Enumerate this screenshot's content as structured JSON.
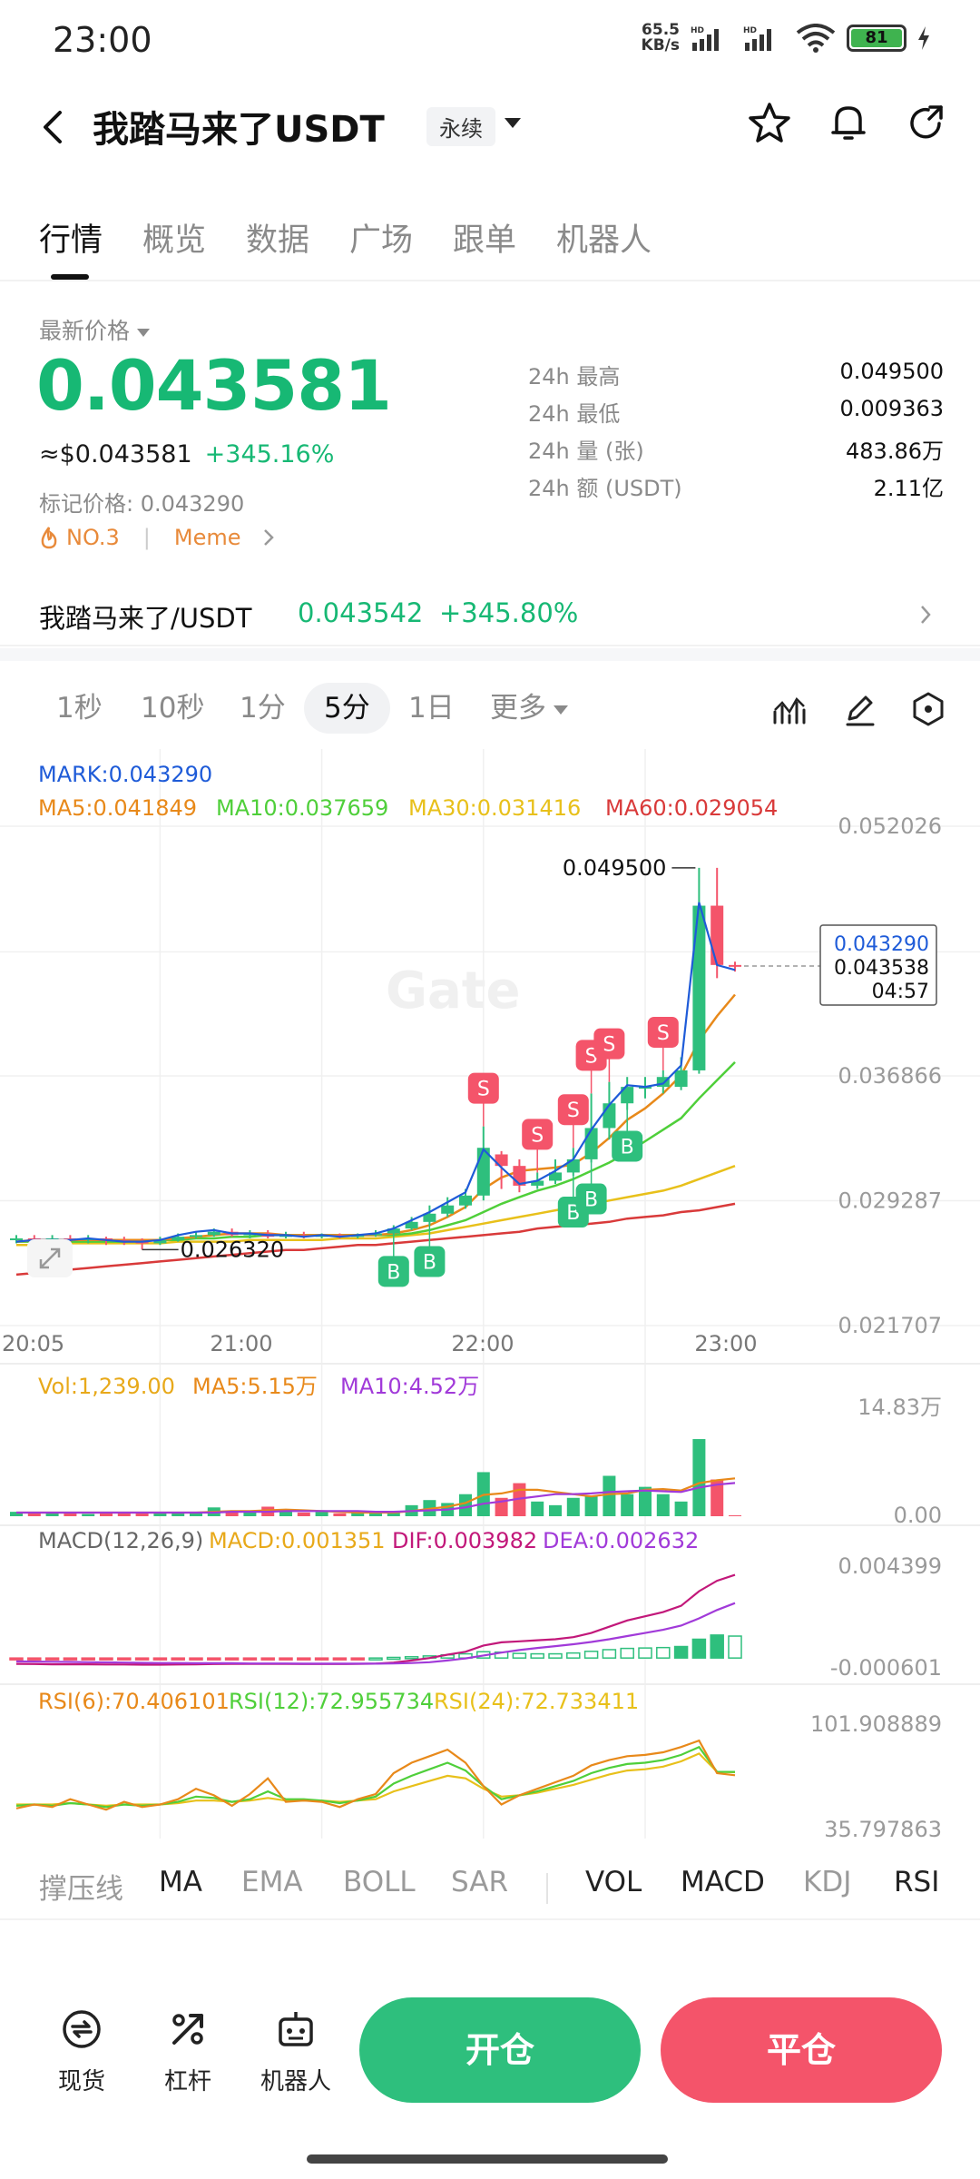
{
  "status_bar": {
    "time": "23:00",
    "net_speed_value": "65.5",
    "net_speed_unit": "KB/s",
    "battery": "81"
  },
  "header": {
    "title": "我踏马来了USDT",
    "contract_type": "永续"
  },
  "tabs": [
    "行情",
    "概览",
    "数据",
    "广场",
    "跟单",
    "机器人"
  ],
  "price": {
    "latest_label": "最新价格",
    "latest": "0.043581",
    "usd": "≈$0.043581",
    "change": "+345.16%",
    "mark_label": "标记价格: 0.043290",
    "rank_tag": "NO.3",
    "category_tag": "Meme"
  },
  "stats": [
    {
      "label": "24h  最高",
      "value": "0.049500"
    },
    {
      "label": "24h  最低",
      "value": "0.009363"
    },
    {
      "label": "24h  量 (张)",
      "value": "483.86万"
    },
    {
      "label": "24h  额 (USDT)",
      "value": "2.11亿"
    }
  ],
  "spot": {
    "name": "我踏马来了/USDT",
    "price": "0.043542",
    "change": "+345.80%"
  },
  "intervals": [
    "1秒",
    "10秒",
    "1分",
    "5分",
    "1日",
    "更多"
  ],
  "intervals_active": "5分",
  "chart": {
    "mark_legend": "MARK:0.043290",
    "ma_legend": [
      {
        "text": "MA5:0.041849",
        "color": "#e8891a"
      },
      {
        "text": "MA10:0.037659",
        "color": "#4fcf3a"
      },
      {
        "text": "MA30:0.031416",
        "color": "#e8c01a"
      },
      {
        "text": "MA60:0.029054",
        "color": "#d93a3a"
      }
    ],
    "watermark": "Gate",
    "high_label": "0.049500",
    "low_label": "0.026320",
    "price_box": {
      "mark": "0.043290",
      "last": "0.043538",
      "countdown": "04:57"
    },
    "vol_legend": [
      {
        "text": "Vol:1,239.00",
        "color": "#e8a91a"
      },
      {
        "text": "MA5:5.15万",
        "color": "#e8891a"
      },
      {
        "text": "MA10:4.52万",
        "color": "#a13ad9"
      }
    ],
    "vol_axis": {
      "top": "14.83万",
      "bottom": "0.00"
    },
    "macd_legend": [
      {
        "text": "MACD(12,26,9)",
        "color": "#666666"
      },
      {
        "text": "MACD:0.001351",
        "color": "#e8a91a"
      },
      {
        "text": "DIF:0.003982",
        "color": "#c2187a"
      },
      {
        "text": "DEA:0.002632",
        "color": "#a13ad9"
      }
    ],
    "macd_axis": {
      "top": "0.004399",
      "bottom": "-0.000601"
    },
    "rsi_legend": [
      {
        "text": "RSI(6):70.406101",
        "color": "#e8891a"
      },
      {
        "text": "RSI(12):72.955734",
        "color": "#4fcf3a"
      },
      {
        "text": "RSI(24):72.733411",
        "color": "#e8c01a"
      }
    ],
    "rsi_axis": {
      "top": "101.908889",
      "bottom": "35.797863"
    }
  },
  "chart_data": {
    "type": "candlestick",
    "x_ticks": [
      "20:05",
      "21:00",
      "22:00",
      "23:00"
    ],
    "y_ticks": [
      "0.052026",
      "0.036866",
      "0.029287",
      "0.021707"
    ],
    "ylim": [
      0.021707,
      0.052026
    ],
    "candles": [
      {
        "o": 0.0269,
        "c": 0.027,
        "h": 0.0272,
        "l": 0.0267
      },
      {
        "o": 0.027,
        "c": 0.0269,
        "h": 0.0272,
        "l": 0.0267
      },
      {
        "o": 0.0269,
        "c": 0.027,
        "h": 0.0272,
        "l": 0.0267
      },
      {
        "o": 0.027,
        "c": 0.0269,
        "h": 0.0272,
        "l": 0.0267
      },
      {
        "o": 0.0269,
        "c": 0.027,
        "h": 0.0272,
        "l": 0.0267
      },
      {
        "o": 0.027,
        "c": 0.0269,
        "h": 0.0271,
        "l": 0.0266
      },
      {
        "o": 0.0269,
        "c": 0.0268,
        "h": 0.0271,
        "l": 0.0266
      },
      {
        "o": 0.0268,
        "c": 0.0267,
        "h": 0.027,
        "l": 0.02632
      },
      {
        "o": 0.0267,
        "c": 0.0269,
        "h": 0.0271,
        "l": 0.0266
      },
      {
        "o": 0.0269,
        "c": 0.0271,
        "h": 0.0273,
        "l": 0.0268
      },
      {
        "o": 0.0271,
        "c": 0.0272,
        "h": 0.0274,
        "l": 0.027
      },
      {
        "o": 0.0272,
        "c": 0.0274,
        "h": 0.0276,
        "l": 0.0271
      },
      {
        "o": 0.0274,
        "c": 0.0272,
        "h": 0.0276,
        "l": 0.0271
      },
      {
        "o": 0.0272,
        "c": 0.0273,
        "h": 0.0275,
        "l": 0.027
      },
      {
        "o": 0.0273,
        "c": 0.0271,
        "h": 0.0275,
        "l": 0.027
      },
      {
        "o": 0.0271,
        "c": 0.0272,
        "h": 0.0274,
        "l": 0.027
      },
      {
        "o": 0.0272,
        "c": 0.0271,
        "h": 0.0274,
        "l": 0.027
      },
      {
        "o": 0.0271,
        "c": 0.0272,
        "h": 0.0273,
        "l": 0.027
      },
      {
        "o": 0.0272,
        "c": 0.0271,
        "h": 0.0273,
        "l": 0.027
      },
      {
        "o": 0.0271,
        "c": 0.0272,
        "h": 0.0273,
        "l": 0.027
      },
      {
        "o": 0.0272,
        "c": 0.0273,
        "h": 0.0275,
        "l": 0.0271
      },
      {
        "o": 0.0273,
        "c": 0.0276,
        "h": 0.0278,
        "l": 0.0272
      },
      {
        "o": 0.0276,
        "c": 0.028,
        "h": 0.0283,
        "l": 0.0275
      },
      {
        "o": 0.028,
        "c": 0.0285,
        "h": 0.029,
        "l": 0.0278
      },
      {
        "o": 0.0285,
        "c": 0.029,
        "h": 0.0295,
        "l": 0.0283
      },
      {
        "o": 0.029,
        "c": 0.0296,
        "h": 0.03,
        "l": 0.0288
      },
      {
        "o": 0.0296,
        "c": 0.0325,
        "h": 0.0338,
        "l": 0.0293
      },
      {
        "o": 0.0321,
        "c": 0.0314,
        "h": 0.0323,
        "l": 0.03
      },
      {
        "o": 0.0314,
        "c": 0.0302,
        "h": 0.0318,
        "l": 0.0298
      },
      {
        "o": 0.0302,
        "c": 0.0305,
        "h": 0.031,
        "l": 0.03
      },
      {
        "o": 0.0305,
        "c": 0.031,
        "h": 0.0318,
        "l": 0.0303
      },
      {
        "o": 0.031,
        "c": 0.0318,
        "h": 0.0325,
        "l": 0.0308
      },
      {
        "o": 0.0318,
        "c": 0.0337,
        "h": 0.0358,
        "l": 0.0316
      },
      {
        "o": 0.0337,
        "c": 0.0352,
        "h": 0.0365,
        "l": 0.033
      },
      {
        "o": 0.0352,
        "c": 0.0362,
        "h": 0.0368,
        "l": 0.0348
      },
      {
        "o": 0.0362,
        "c": 0.0362,
        "h": 0.0368,
        "l": 0.0355
      },
      {
        "o": 0.0362,
        "c": 0.0368,
        "h": 0.0372,
        "l": 0.0358
      },
      {
        "o": 0.0362,
        "c": 0.0372,
        "h": 0.038,
        "l": 0.036
      },
      {
        "o": 0.0372,
        "c": 0.0472,
        "h": 0.0495,
        "l": 0.037
      },
      {
        "o": 0.0472,
        "c": 0.0436,
        "h": 0.0495,
        "l": 0.0428
      },
      {
        "o": 0.0436,
        "c": 0.0435,
        "h": 0.0438,
        "l": 0.0432
      }
    ],
    "mark_line": [
      0.0268,
      0.0269,
      0.0269,
      0.0269,
      0.027,
      0.0269,
      0.0268,
      0.0268,
      0.0269,
      0.0272,
      0.0274,
      0.0275,
      0.0273,
      0.0273,
      0.0272,
      0.0272,
      0.0271,
      0.0272,
      0.0271,
      0.0272,
      0.0273,
      0.0276,
      0.0281,
      0.0286,
      0.0292,
      0.0298,
      0.0324,
      0.0313,
      0.0303,
      0.0305,
      0.0311,
      0.0318,
      0.0336,
      0.0351,
      0.0363,
      0.0362,
      0.0364,
      0.0375,
      0.0474,
      0.0436,
      0.0433
    ],
    "ma5": [
      0.0268,
      0.0269,
      0.0269,
      0.0269,
      0.0269,
      0.0269,
      0.0269,
      0.0269,
      0.0269,
      0.027,
      0.0271,
      0.0272,
      0.0273,
      0.0273,
      0.0273,
      0.0272,
      0.0272,
      0.0272,
      0.0272,
      0.0272,
      0.0272,
      0.0273,
      0.0275,
      0.0278,
      0.0283,
      0.0289,
      0.03,
      0.0307,
      0.0311,
      0.0312,
      0.0313,
      0.0315,
      0.0322,
      0.0331,
      0.0342,
      0.0349,
      0.0358,
      0.0369,
      0.039,
      0.0405,
      0.0418
    ],
    "ma10": [
      0.0268,
      0.0268,
      0.0268,
      0.0268,
      0.0268,
      0.0268,
      0.0268,
      0.0269,
      0.0269,
      0.0269,
      0.027,
      0.027,
      0.0271,
      0.0271,
      0.0272,
      0.0272,
      0.0272,
      0.0272,
      0.0272,
      0.0272,
      0.0272,
      0.0272,
      0.0273,
      0.0275,
      0.0278,
      0.0281,
      0.0286,
      0.0291,
      0.0295,
      0.0299,
      0.0302,
      0.0306,
      0.0311,
      0.0316,
      0.0322,
      0.0329,
      0.0336,
      0.0343,
      0.0355,
      0.0366,
      0.0377
    ],
    "ma30": [
      0.0266,
      0.0266,
      0.0266,
      0.0267,
      0.0267,
      0.0267,
      0.0267,
      0.0267,
      0.0267,
      0.0268,
      0.0268,
      0.0268,
      0.0268,
      0.0269,
      0.0269,
      0.0269,
      0.0269,
      0.0269,
      0.027,
      0.027,
      0.027,
      0.0271,
      0.0272,
      0.0273,
      0.0275,
      0.0277,
      0.0279,
      0.0281,
      0.0283,
      0.0285,
      0.0287,
      0.0289,
      0.0291,
      0.0293,
      0.0295,
      0.0297,
      0.0299,
      0.0302,
      0.0306,
      0.031,
      0.0314
    ],
    "ma60": [
      0.0248,
      0.0249,
      0.025,
      0.0251,
      0.0252,
      0.0253,
      0.0254,
      0.0255,
      0.0256,
      0.0257,
      0.0258,
      0.0259,
      0.026,
      0.0261,
      0.0262,
      0.0263,
      0.0263,
      0.0264,
      0.0265,
      0.0266,
      0.0266,
      0.0267,
      0.0268,
      0.0269,
      0.027,
      0.0271,
      0.0272,
      0.0273,
      0.0274,
      0.0276,
      0.0277,
      0.0278,
      0.0279,
      0.028,
      0.0282,
      0.0283,
      0.0284,
      0.0286,
      0.0287,
      0.0289,
      0.0291
    ],
    "trade_markers": [
      {
        "i": 21,
        "side": "B"
      },
      {
        "i": 23,
        "side": "B"
      },
      {
        "i": 26,
        "side": "S"
      },
      {
        "i": 29,
        "side": "S"
      },
      {
        "i": 31,
        "side": "B"
      },
      {
        "i": 31,
        "side": "S"
      },
      {
        "i": 32,
        "side": "B"
      },
      {
        "i": 32,
        "side": "S"
      },
      {
        "i": 33,
        "side": "S"
      },
      {
        "i": 34,
        "side": "B"
      },
      {
        "i": 36,
        "side": "S"
      }
    ],
    "volume": [
      0.6,
      0.4,
      0.5,
      0.6,
      0.3,
      0.5,
      0.4,
      0.6,
      0.5,
      0.4,
      0.5,
      1.2,
      0.8,
      0.5,
      1.3,
      0.7,
      0.5,
      0.6,
      0.4,
      0.5,
      0.4,
      0.6,
      1.5,
      2.2,
      1.8,
      3.0,
      6.0,
      2.5,
      4.5,
      2.0,
      1.5,
      2.5,
      2.8,
      5.5,
      3.0,
      4.0,
      3.0,
      2.0,
      10.5,
      5.0,
      0.12
    ],
    "vol_ma5": [
      0.5,
      0.5,
      0.5,
      0.5,
      0.5,
      0.5,
      0.5,
      0.5,
      0.5,
      0.5,
      0.5,
      0.6,
      0.7,
      0.7,
      0.8,
      0.9,
      0.8,
      0.7,
      0.6,
      0.5,
      0.5,
      0.5,
      0.7,
      1.0,
      1.3,
      1.8,
      2.9,
      3.1,
      3.6,
      3.6,
      3.3,
      3.0,
      2.7,
      3.0,
      3.1,
      3.6,
      3.7,
      3.5,
      4.5,
      4.9,
      5.15
    ],
    "vol_ma10": [
      0.5,
      0.5,
      0.5,
      0.5,
      0.5,
      0.5,
      0.5,
      0.5,
      0.5,
      0.5,
      0.5,
      0.5,
      0.6,
      0.6,
      0.6,
      0.7,
      0.7,
      0.7,
      0.7,
      0.7,
      0.6,
      0.6,
      0.7,
      0.8,
      0.9,
      1.2,
      1.7,
      2.0,
      2.4,
      2.7,
      3.0,
      3.0,
      3.1,
      3.3,
      3.4,
      3.5,
      3.4,
      3.3,
      3.9,
      4.3,
      4.52
    ],
    "macd_hist": [
      -4e-05,
      -4e-05,
      -4e-05,
      -4e-05,
      -4e-05,
      -4e-05,
      -4e-05,
      -4e-05,
      -3e-05,
      -3e-05,
      -2e-05,
      -2e-05,
      -2e-05,
      -2e-05,
      -2e-05,
      -2e-05,
      -2e-05,
      -2e-05,
      -2e-05,
      -1e-05,
      0.0,
      3e-05,
      6e-05,
      0.0001,
      0.00015,
      0.0002,
      0.0003,
      0.00028,
      0.00022,
      0.0002,
      0.0002,
      0.00024,
      0.00032,
      0.0004,
      0.00046,
      0.00048,
      0.0005,
      0.00055,
      0.0009,
      0.0011,
      0.00105
    ],
    "macd_dif": [
      -0.00028,
      -0.00029,
      -0.0003,
      -0.0003,
      -0.0003,
      -0.00031,
      -0.00031,
      -0.00032,
      -0.00032,
      -0.00031,
      -0.0003,
      -0.00029,
      -0.00028,
      -0.00028,
      -0.00028,
      -0.00028,
      -0.00029,
      -0.00029,
      -0.00029,
      -0.00028,
      -0.00027,
      -0.00022,
      -0.00012,
      0.0,
      0.00016,
      0.0003,
      0.0006,
      0.00075,
      0.0008,
      0.00085,
      0.0009,
      0.001,
      0.0012,
      0.0015,
      0.0018,
      0.002,
      0.0022,
      0.0025,
      0.0032,
      0.0037,
      0.00398
    ],
    "macd_dea": [
      -0.00016,
      -0.00017,
      -0.00018,
      -0.00019,
      -0.0002,
      -0.00021,
      -0.00022,
      -0.00023,
      -0.00024,
      -0.00024,
      -0.00025,
      -0.00025,
      -0.00025,
      -0.00026,
      -0.00026,
      -0.00026,
      -0.00027,
      -0.00027,
      -0.00027,
      -0.00027,
      -0.00027,
      -0.00026,
      -0.00024,
      -0.0002,
      -0.00012,
      -2e-05,
      0.00012,
      0.00026,
      0.00038,
      0.00048,
      0.00057,
      0.00066,
      0.00077,
      0.0009,
      0.00105,
      0.0012,
      0.00135,
      0.00155,
      0.0019,
      0.0023,
      0.00263
    ],
    "rsi6": [
      45,
      48,
      46,
      52,
      48,
      44,
      50,
      46,
      48,
      52,
      60,
      55,
      47,
      56,
      68,
      50,
      51,
      50,
      46,
      52,
      56,
      72,
      80,
      85,
      90,
      80,
      62,
      48,
      55,
      60,
      65,
      70,
      78,
      82,
      85,
      86,
      88,
      92,
      97,
      72,
      70.4
    ],
    "rsi12": [
      47,
      48,
      47,
      49,
      48,
      46,
      48,
      47,
      48,
      50,
      54,
      53,
      50,
      52,
      58,
      52,
      52,
      51,
      49,
      51,
      54,
      64,
      70,
      75,
      80,
      74,
      62,
      52,
      55,
      58,
      62,
      66,
      72,
      76,
      79,
      80,
      82,
      86,
      92,
      73,
      72.96
    ],
    "rsi24": [
      48,
      48,
      48,
      49,
      48,
      47,
      48,
      48,
      48,
      49,
      51,
      51,
      50,
      51,
      53,
      51,
      51,
      51,
      50,
      51,
      52,
      58,
      62,
      66,
      70,
      68,
      60,
      54,
      55,
      57,
      60,
      63,
      67,
      71,
      74,
      75,
      77,
      81,
      87,
      73,
      72.73
    ]
  },
  "indicator_tabs": [
    {
      "label": "撑压线",
      "dark": false
    },
    {
      "label": "MA",
      "dark": true
    },
    {
      "label": "EMA",
      "dark": false
    },
    {
      "label": "BOLL",
      "dark": false
    },
    {
      "label": "SAR",
      "dark": false
    },
    {
      "label": "VOL",
      "dark": true
    },
    {
      "label": "MACD",
      "dark": true
    },
    {
      "label": "KDJ",
      "dark": false
    },
    {
      "label": "RSI",
      "dark": true
    }
  ],
  "bottom_bar": {
    "spot": "现货",
    "leverage": "杠杆",
    "bot": "机器人",
    "open": "开仓",
    "close": "平仓"
  },
  "colors": {
    "up": "#2ebf7d",
    "down": "#f4546a",
    "mark": "#1e5bd8"
  }
}
